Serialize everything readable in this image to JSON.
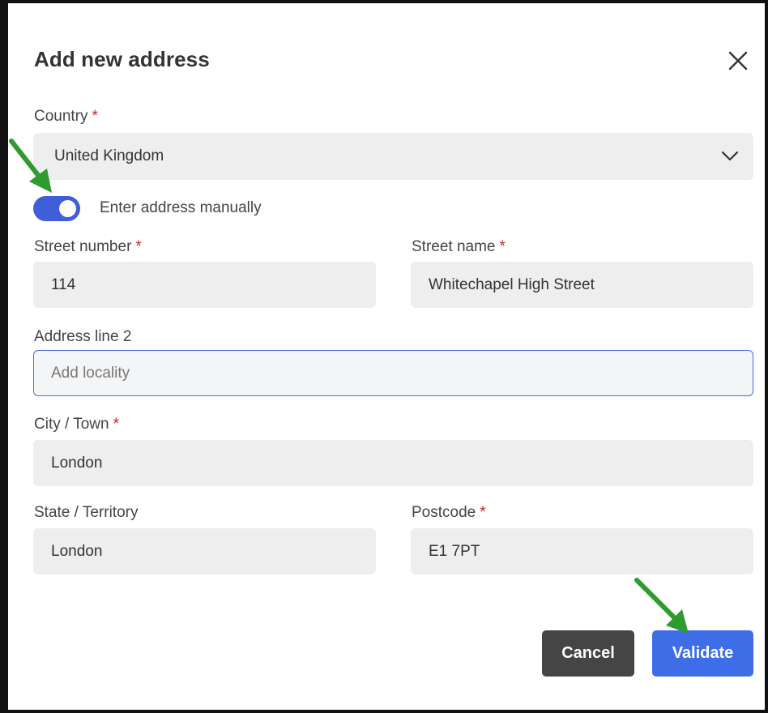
{
  "dialog": {
    "title": "Add new address"
  },
  "country": {
    "label": "Country",
    "required_mark": "*",
    "value": "United Kingdom"
  },
  "manual_toggle": {
    "label": "Enter address manually",
    "on": true
  },
  "street_number": {
    "label": "Street number",
    "required_mark": "*",
    "value": "114"
  },
  "street_name": {
    "label": "Street name",
    "required_mark": "*",
    "value": "Whitechapel High Street"
  },
  "address_line2": {
    "label": "Address line 2",
    "placeholder": "Add locality",
    "value": ""
  },
  "city": {
    "label": "City / Town",
    "required_mark": "*",
    "value": "London"
  },
  "state": {
    "label": "State / Territory",
    "value": "London"
  },
  "postcode": {
    "label": "Postcode",
    "required_mark": "*",
    "value": "E1 7PT"
  },
  "buttons": {
    "cancel": "Cancel",
    "validate": "Validate"
  },
  "colors": {
    "accent": "#3d6ee8",
    "toggle": "#3f5fd8",
    "cancel_bg": "#454545",
    "required": "#d62020",
    "annotation_arrow": "#2e9b2e"
  },
  "icons": {
    "close": "close-icon",
    "dropdown": "chevron-down-icon",
    "annotation": "green-arrow-annotation"
  }
}
